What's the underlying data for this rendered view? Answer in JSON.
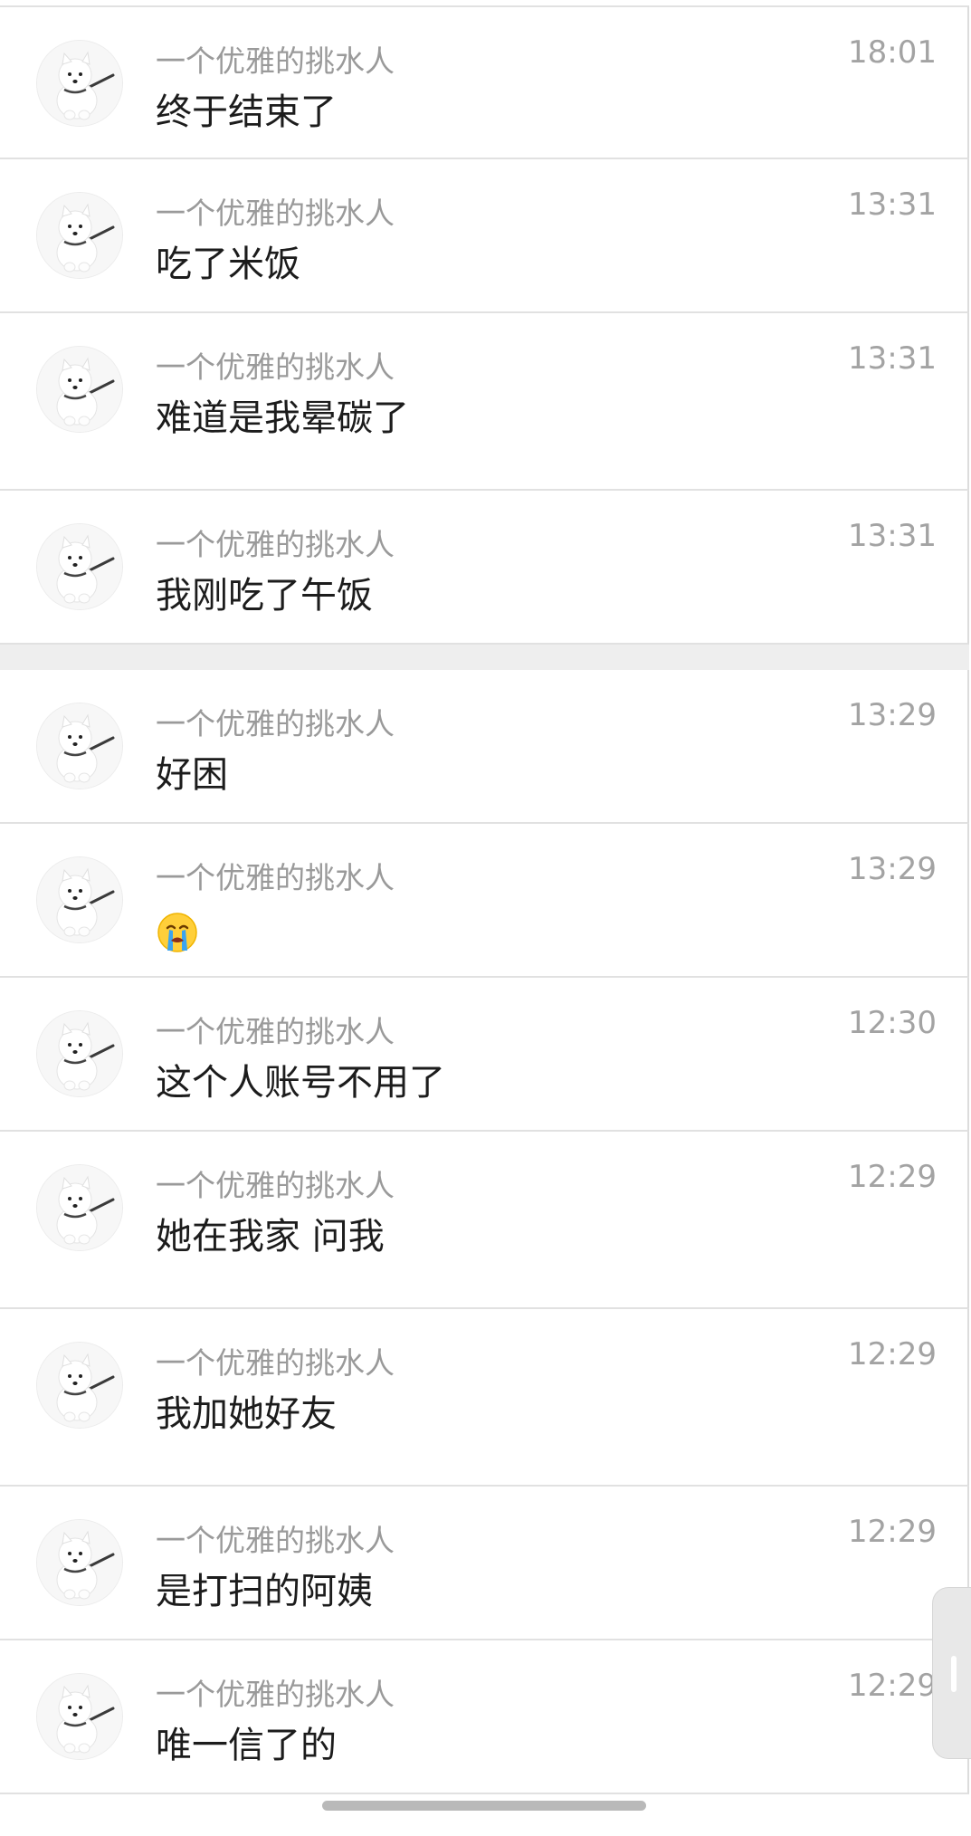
{
  "messages": [
    {
      "sender": "一个优雅的挑水人",
      "text": "终于结束了",
      "time": "18:01",
      "avatar_icon": "samoyed-dog-avatar"
    },
    {
      "sender": "一个优雅的挑水人",
      "text": "吃了米饭",
      "time": "13:31",
      "avatar_icon": "samoyed-dog-avatar"
    },
    {
      "sender": "一个优雅的挑水人",
      "text": "难道是我晕碳了",
      "time": "13:31",
      "avatar_icon": "samoyed-dog-avatar"
    },
    {
      "sender": "一个优雅的挑水人",
      "text": "我刚吃了午饭",
      "time": "13:31",
      "avatar_icon": "samoyed-dog-avatar"
    },
    {
      "sender": "一个优雅的挑水人",
      "text": "好困",
      "time": "13:29",
      "avatar_icon": "samoyed-dog-avatar"
    },
    {
      "sender": "一个优雅的挑水人",
      "text": "",
      "emoji": "loudly-crying-face-emoji",
      "time": "13:29",
      "avatar_icon": "samoyed-dog-avatar"
    },
    {
      "sender": "一个优雅的挑水人",
      "text": "这个人账号不用了",
      "time": "12:30",
      "avatar_icon": "samoyed-dog-avatar"
    },
    {
      "sender": "一个优雅的挑水人",
      "text": "她在我家 问我",
      "time": "12:29",
      "avatar_icon": "samoyed-dog-avatar"
    },
    {
      "sender": "一个优雅的挑水人",
      "text": "我加她好友",
      "time": "12:29",
      "avatar_icon": "samoyed-dog-avatar"
    },
    {
      "sender": "一个优雅的挑水人",
      "text": "是打扫的阿姨",
      "time": "12:29",
      "avatar_icon": "samoyed-dog-avatar"
    },
    {
      "sender": "一个优雅的挑水人",
      "text": "唯一信了的",
      "time": "12:29",
      "avatar_icon": "samoyed-dog-avatar"
    }
  ],
  "colors": {
    "background": "#ffffff",
    "divider": "#e1e1e1",
    "section_gap": "#eeeeee",
    "sender_text": "#9a9a9a",
    "message_text": "#1c1c1c",
    "time_text": "#a3a3a3"
  }
}
